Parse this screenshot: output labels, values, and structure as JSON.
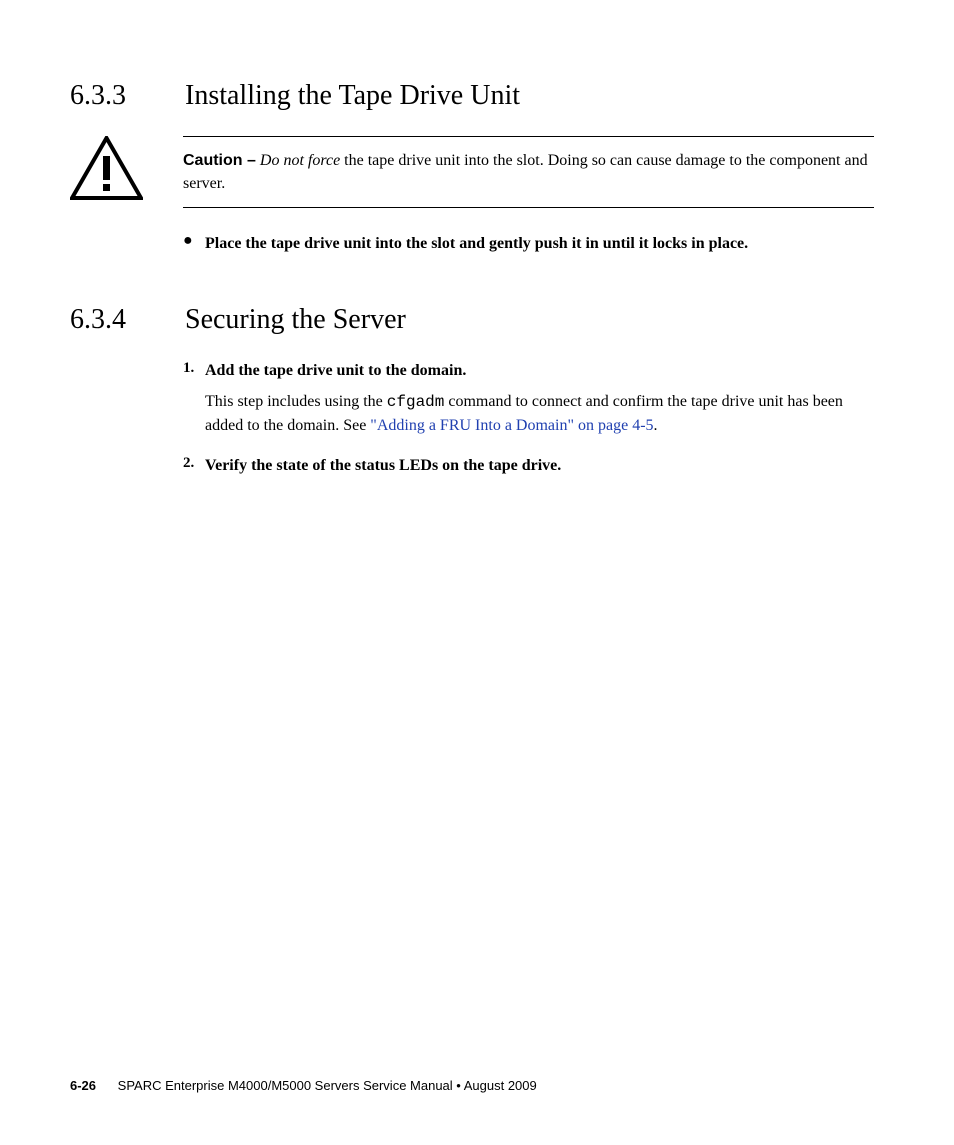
{
  "sections": [
    {
      "num": "6.3.3",
      "title": "Installing the Tape Drive Unit"
    },
    {
      "num": "6.3.4",
      "title": "Securing the Server"
    }
  ],
  "caution": {
    "label": "Caution –",
    "lead_italic": "Do not force",
    "rest": " the tape drive unit into the slot. Doing so can cause damage to the component and server."
  },
  "bullet": "Place the tape drive unit into the slot and gently push it in until it locks in place.",
  "steps": [
    {
      "num": "1.",
      "title": "Add the tape drive unit to the domain.",
      "body_pre": "This step includes using the ",
      "code": "cfgadm",
      "body_mid": " command to connect and confirm the tape drive unit has been added to the domain. See ",
      "link": "\"Adding a FRU Into a Domain\" on page 4-5",
      "body_post": "."
    },
    {
      "num": "2.",
      "title": "Verify the state of the status LEDs on the tape drive."
    }
  ],
  "footer": {
    "pagenum": "6-26",
    "text": "SPARC Enterprise M4000/M5000 Servers Service Manual • August 2009"
  }
}
